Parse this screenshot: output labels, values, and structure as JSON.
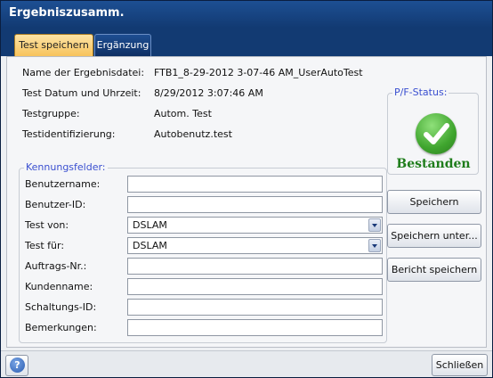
{
  "window": {
    "title": "Ergebniszusamm."
  },
  "tabs": [
    {
      "label": "Test speichern",
      "active": true
    },
    {
      "label": "Ergänzung",
      "active": false
    }
  ],
  "info": [
    {
      "label": "Name der Ergebnisdatei:",
      "value": "FTB1_8-29-2012 3-07-46 AM_UserAutoTest"
    },
    {
      "label": "Test Datum und Uhrzeit:",
      "value": "8/29/2012 3:07:46 AM"
    },
    {
      "label": "Testgruppe:",
      "value": "Autom. Test"
    },
    {
      "label": "Testidentifizierung:",
      "value": "Autobenutz.test"
    }
  ],
  "pf_status": {
    "legend": "P/F-Status:",
    "result": "Bestanden",
    "icon": "checkmark-icon",
    "color": "#1f7d1b"
  },
  "ids": {
    "legend": "Kennungsfelder:",
    "fields": [
      {
        "label": "Benutzername:",
        "value": ""
      },
      {
        "label": "Benutzer-ID:",
        "value": ""
      },
      {
        "label": "Test von:",
        "value": "DSLAM"
      },
      {
        "label": "Test für:",
        "value": "DSLAM"
      },
      {
        "label": "Auftrags-Nr.:",
        "value": ""
      },
      {
        "label": "Kundenname:",
        "value": ""
      },
      {
        "label": "Schaltungs-ID:",
        "value": ""
      },
      {
        "label": "Bemerkungen:",
        "value": ""
      }
    ]
  },
  "buttons": {
    "save": "Speichern",
    "save_as": "Speichern unter...",
    "save_report": "Bericht speichern",
    "close": "Schließen"
  },
  "colors": {
    "titlebar": "#123a72",
    "accent_tab": "#f7c35c",
    "legend": "#3a4fd0"
  }
}
